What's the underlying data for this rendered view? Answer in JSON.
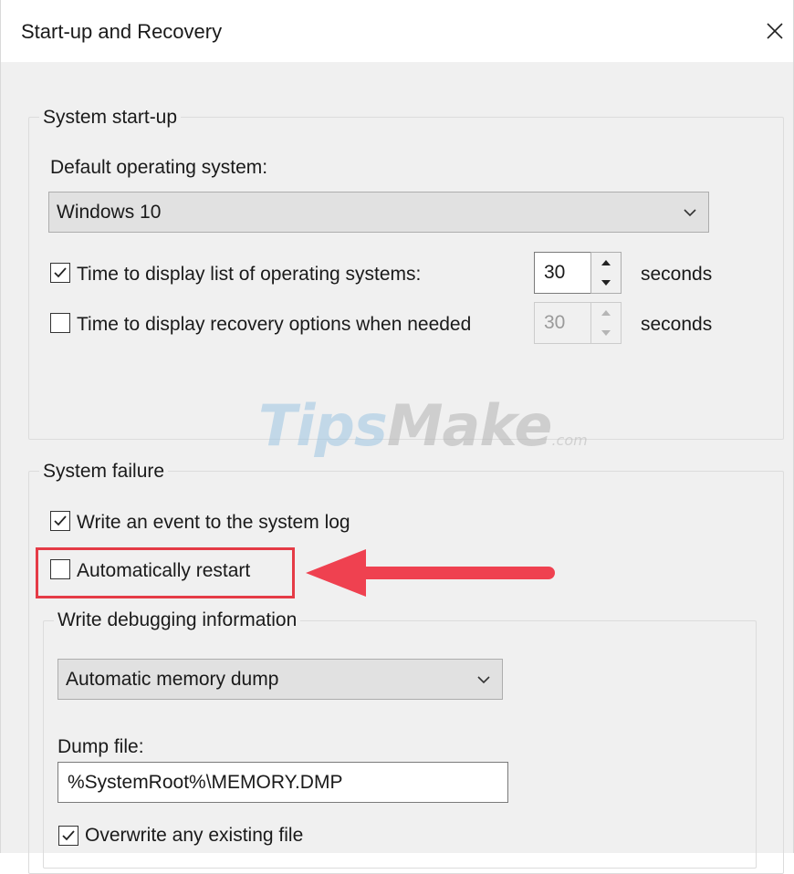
{
  "window": {
    "title": "Start-up and Recovery",
    "close_glyph": "✕"
  },
  "system_startup": {
    "legend": "System start-up",
    "default_os_label": "Default operating system:",
    "default_os_value": "Windows 10",
    "time_list": {
      "label": "Time to display list of operating systems:",
      "checked": true,
      "value": "30",
      "unit": "seconds"
    },
    "time_recovery": {
      "label": "Time to display recovery options when needed",
      "checked": false,
      "value": "30",
      "unit": "seconds",
      "disabled": true
    }
  },
  "watermark": {
    "tips": "Tips",
    "make": "Make",
    "suffix": ".com",
    "tips_color": "#9ec6e3",
    "make_color": "#b3b3b3"
  },
  "system_failure": {
    "legend": "System failure",
    "write_event": {
      "label": "Write an event to the system log",
      "checked": true
    },
    "auto_restart": {
      "label": "Automatically restart",
      "checked": false
    },
    "debug": {
      "legend": "Write debugging information",
      "dump_type": "Automatic memory dump",
      "dump_file_label": "Dump file:",
      "dump_file_value": "%SystemRoot%\\MEMORY.DMP",
      "overwrite": {
        "label": "Overwrite any existing file",
        "checked": true
      }
    }
  },
  "annotation": {
    "highlight_color": "#e53b46",
    "arrow_color": "#ef4150"
  }
}
